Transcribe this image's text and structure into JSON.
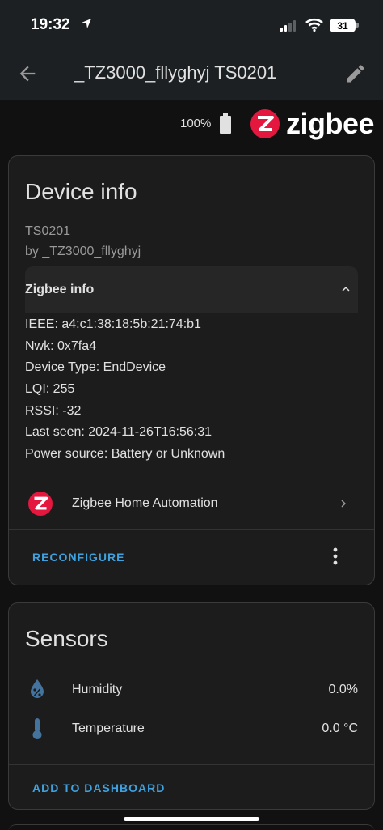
{
  "status": {
    "time": "19:32",
    "battery_level": "31"
  },
  "header": {
    "title": "_TZ3000_fllyghyj TS0201"
  },
  "device_summary": {
    "battery": "100%",
    "brand": "zigbee"
  },
  "device_info": {
    "title": "Device info",
    "model": "TS0201",
    "manufacturer": "by _TZ3000_fllyghyj",
    "zigbee_info_label": "Zigbee info",
    "fields": {
      "ieee": "IEEE: a4:c1:38:18:5b:21:74:b1",
      "nwk": "Nwk: 0x7fa4",
      "device_type": "Device Type: EndDevice",
      "lqi": "LQI: 255",
      "rssi": "RSSI: -32",
      "last_seen": "Last seen: 2024-11-26T16:56:31",
      "power_source": "Power source: Battery or Unknown"
    },
    "integration": "Zigbee Home Automation",
    "reconfigure_label": "RECONFIGURE"
  },
  "sensors": {
    "title": "Sensors",
    "items": [
      {
        "label": "Humidity",
        "value": "0.0%",
        "icon": "water-percent-icon"
      },
      {
        "label": "Temperature",
        "value": "0.0 °C",
        "icon": "thermometer-icon"
      }
    ],
    "add_label": "ADD TO DASHBOARD"
  },
  "colors": {
    "accent": "#3fa2e0",
    "zigbee_red": "#e4173f",
    "icon_blue": "#44739e"
  }
}
